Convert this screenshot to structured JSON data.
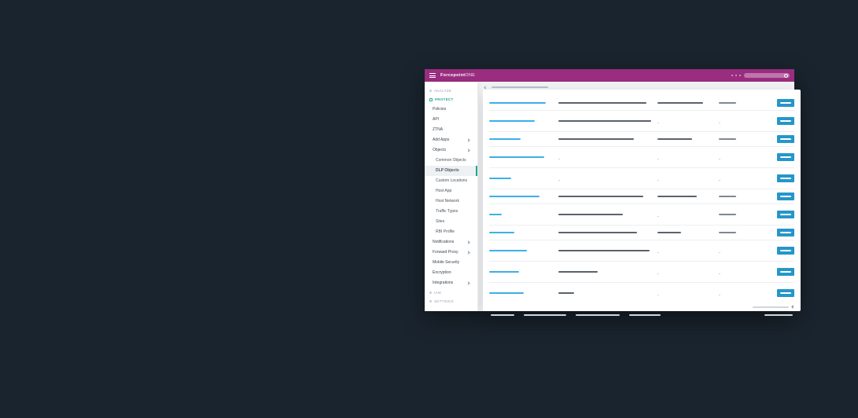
{
  "brand": {
    "bold": "Forcepoint",
    "light": "ONE"
  },
  "sidebar": {
    "sections": [
      {
        "label": "ANALYZE",
        "active": false
      },
      {
        "label": "PROTECT",
        "active": true
      },
      {
        "label": "IAM",
        "active": false
      },
      {
        "label": "SETTINGS",
        "active": false
      }
    ],
    "items": [
      {
        "label": "Policies",
        "sub": false,
        "expand": false
      },
      {
        "label": "API",
        "sub": false,
        "expand": false
      },
      {
        "label": "ZTNA",
        "sub": false,
        "expand": false
      },
      {
        "label": "Add Apps",
        "sub": false,
        "expand": true
      },
      {
        "label": "Objects",
        "sub": false,
        "expand": true
      },
      {
        "label": "Common Objects",
        "sub": true,
        "expand": false
      },
      {
        "label": "DLP Objects",
        "sub": true,
        "expand": false,
        "active": true
      },
      {
        "label": "Custom Locations",
        "sub": true,
        "expand": false
      },
      {
        "label": "Host App",
        "sub": true,
        "expand": false
      },
      {
        "label": "Host Network",
        "sub": true,
        "expand": false
      },
      {
        "label": "Traffic Types",
        "sub": true,
        "expand": false
      },
      {
        "label": "Sites",
        "sub": true,
        "expand": false
      },
      {
        "label": "RBI Profile",
        "sub": true,
        "expand": false
      },
      {
        "label": "Notifications",
        "sub": false,
        "expand": true
      },
      {
        "label": "Forward Proxy",
        "sub": false,
        "expand": true
      },
      {
        "label": "Mobile Security",
        "sub": false,
        "expand": false
      },
      {
        "label": "Encryption",
        "sub": false,
        "expand": false
      },
      {
        "label": "Integrations",
        "sub": false,
        "expand": true
      }
    ]
  },
  "table": {
    "rows": [
      {
        "c1w": 72,
        "c2w": 112,
        "c2dash": false,
        "c3w": 58,
        "c3dash": false,
        "c4w": 22
      },
      {
        "c1w": 58,
        "c2w": 118,
        "c2dash": false,
        "c3w": 0,
        "c3dash": true,
        "c4w": 22,
        "c4dash": true
      },
      {
        "c1w": 40,
        "c2w": 96,
        "c2dash": false,
        "c3w": 44,
        "c3dash": false,
        "c4w": 22
      },
      {
        "c1w": 70,
        "c2w": 0,
        "c2dash": true,
        "c3w": 0,
        "c3dash": true,
        "c4w": 22,
        "c4dash": true
      },
      {
        "c1w": 28,
        "c2w": 0,
        "c2dash": true,
        "c3w": 0,
        "c3dash": true,
        "c4w": 22,
        "c4dash": true
      },
      {
        "c1w": 64,
        "c2w": 108,
        "c2dash": false,
        "c3w": 50,
        "c3dash": false,
        "c4w": 22
      },
      {
        "c1w": 16,
        "c2w": 82,
        "c2dash": false,
        "c3w": 0,
        "c3dash": true,
        "c4w": 22
      },
      {
        "c1w": 32,
        "c2w": 100,
        "c2dash": false,
        "c3w": 30,
        "c3dash": false,
        "c4w": 22
      },
      {
        "c1w": 48,
        "c2w": 116,
        "c2dash": false,
        "c3w": 0,
        "c3dash": true,
        "c4w": 22,
        "c4dash": true
      },
      {
        "c1w": 38,
        "c2w": 50,
        "c2dash": false,
        "c3w": 0,
        "c3dash": true,
        "c4w": 22,
        "c4dash": true
      },
      {
        "c1w": 44,
        "c2w": 20,
        "c2dash": false,
        "c3w": 0,
        "c3dash": true,
        "c4w": 22,
        "c4dash": true
      }
    ]
  }
}
